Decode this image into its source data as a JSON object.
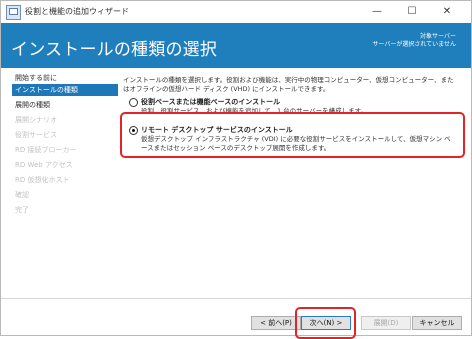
{
  "window": {
    "title": "役割と機能の追加ウィザード",
    "minimize": "—",
    "maximize": "☐",
    "close": "✕"
  },
  "header": {
    "title": "インストールの種類の選択",
    "target_label": "対象サーバー",
    "target_value": "サーバーが選択されていません"
  },
  "nav": {
    "items": [
      {
        "label": "開始する前に",
        "state": "normal"
      },
      {
        "label": "インストールの種類",
        "state": "selected"
      },
      {
        "label": "展開の種類",
        "state": "normal"
      },
      {
        "label": "展開シナリオ",
        "state": "disabled"
      },
      {
        "label": "役割サービス",
        "state": "disabled"
      },
      {
        "label": "RD 接続ブローカー",
        "state": "disabled"
      },
      {
        "label": "RD Web アクセス",
        "state": "disabled"
      },
      {
        "label": "RD 仮想化ホスト",
        "state": "disabled"
      },
      {
        "label": "確認",
        "state": "disabled"
      },
      {
        "label": "完了",
        "state": "disabled"
      }
    ]
  },
  "content": {
    "description": "インストールの種類を選択します。役割および機能は、実行中の物理コンピューター、仮想コンピューター、またはオフラインの仮想ハード ディスク (VHD) にインストールできます。",
    "options": [
      {
        "label": "役割ベースまたは機能ベースのインストール",
        "description": "役割、役割サービス、および機能を追加して、1 台のサーバーを構成します。",
        "selected": false
      },
      {
        "label": "リモート デスクトップ サービスのインストール",
        "description": "仮想デスクトップ インフラストラクチャ (VDI) に必要な役割サービスをインストールして、仮想マシン ベースまたはセッション ベースのデスクトップ展開を作成します。",
        "selected": true
      }
    ]
  },
  "footer": {
    "back": "< 前へ(P)",
    "next": "次へ(N) >",
    "install": "展開(D)",
    "cancel": "キャンセル"
  },
  "colors": {
    "header": "#1f7fbd",
    "selected_nav": "#1e78b8",
    "annotation_red": "#e32424"
  }
}
